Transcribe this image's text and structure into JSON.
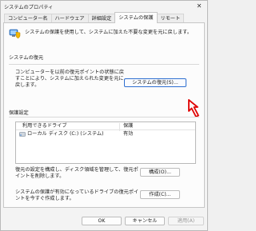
{
  "window": {
    "title": "システムのプロパティ",
    "close_glyph": "✕"
  },
  "tabs": [
    {
      "label": "コンピューター名",
      "active": false
    },
    {
      "label": "ハードウェア",
      "active": false
    },
    {
      "label": "詳細設定",
      "active": false
    },
    {
      "label": "システムの保護",
      "active": true
    },
    {
      "label": "リモート",
      "active": false
    }
  ],
  "intro": {
    "icon": "shield-pc-icon",
    "text": "システムの保護を使用して、システムに加えた不要な変更を元に戻します。"
  },
  "restore": {
    "group_label": "システムの復元",
    "description": "コンピューターを以前の復元ポイントの状態に戻すことにより、システムに加えられた変更を元に戻します。",
    "button_label": "システムの復元(S)..."
  },
  "protection": {
    "group_label": "保護設定",
    "columns": [
      "利用できるドライブ",
      "保護"
    ],
    "drives": [
      {
        "name": "ローカル ディスク (C:) (システム)",
        "status": "有効",
        "icon": "drive-icon"
      }
    ],
    "configure_description": "復元の設定を構成し、ディスク領域を管理して、復元ポイントを削除します。",
    "configure_button": "構成(O)...",
    "create_description": "システムの保護が有効になっているドライブの復元ポイントを今すぐ作成します。",
    "create_button": "作成(C)..."
  },
  "footer": {
    "ok": "OK",
    "cancel": "キャンセル",
    "apply": "適用(A)"
  },
  "colors": {
    "accent": "#2f6fd0",
    "annotation_arrow": "#e00000"
  }
}
